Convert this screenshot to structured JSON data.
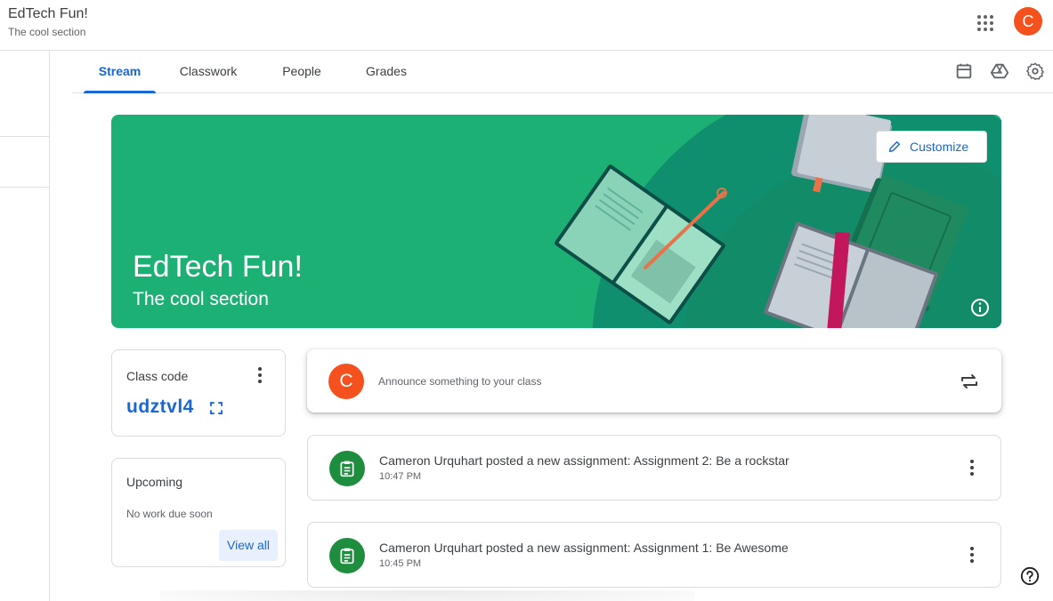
{
  "header": {
    "title": "EdTech Fun!",
    "subtitle": "The cool section",
    "apps_icon": "apps-grid-icon",
    "avatar_initial": "C"
  },
  "tabs": [
    {
      "label": "Stream",
      "active": true
    },
    {
      "label": "Classwork",
      "active": false
    },
    {
      "label": "People",
      "active": false
    },
    {
      "label": "Grades",
      "active": false
    }
  ],
  "tab_actions": [
    "calendar-icon",
    "drive-icon",
    "settings-gear-icon"
  ],
  "banner": {
    "title": "EdTech Fun!",
    "subtitle": "The cool section",
    "customize_label": "Customize",
    "color": "#1db075"
  },
  "class_code": {
    "label": "Class code",
    "code": "udztvl4"
  },
  "upcoming": {
    "label": "Upcoming",
    "empty_text": "No work due soon",
    "view_all_label": "View all"
  },
  "announce": {
    "avatar_initial": "C",
    "placeholder": "Announce something to your class"
  },
  "posts": [
    {
      "title": "Cameron Urquhart posted a new assignment: Assignment 2: Be a rockstar",
      "time": "10:47 PM"
    },
    {
      "title": "Cameron Urquhart posted a new assignment: Assignment 1: Be Awesome",
      "time": "10:45 PM"
    }
  ],
  "colors": {
    "accent": "#1967d2",
    "avatar": "#f4511e",
    "assignment": "#1e8e3e"
  }
}
